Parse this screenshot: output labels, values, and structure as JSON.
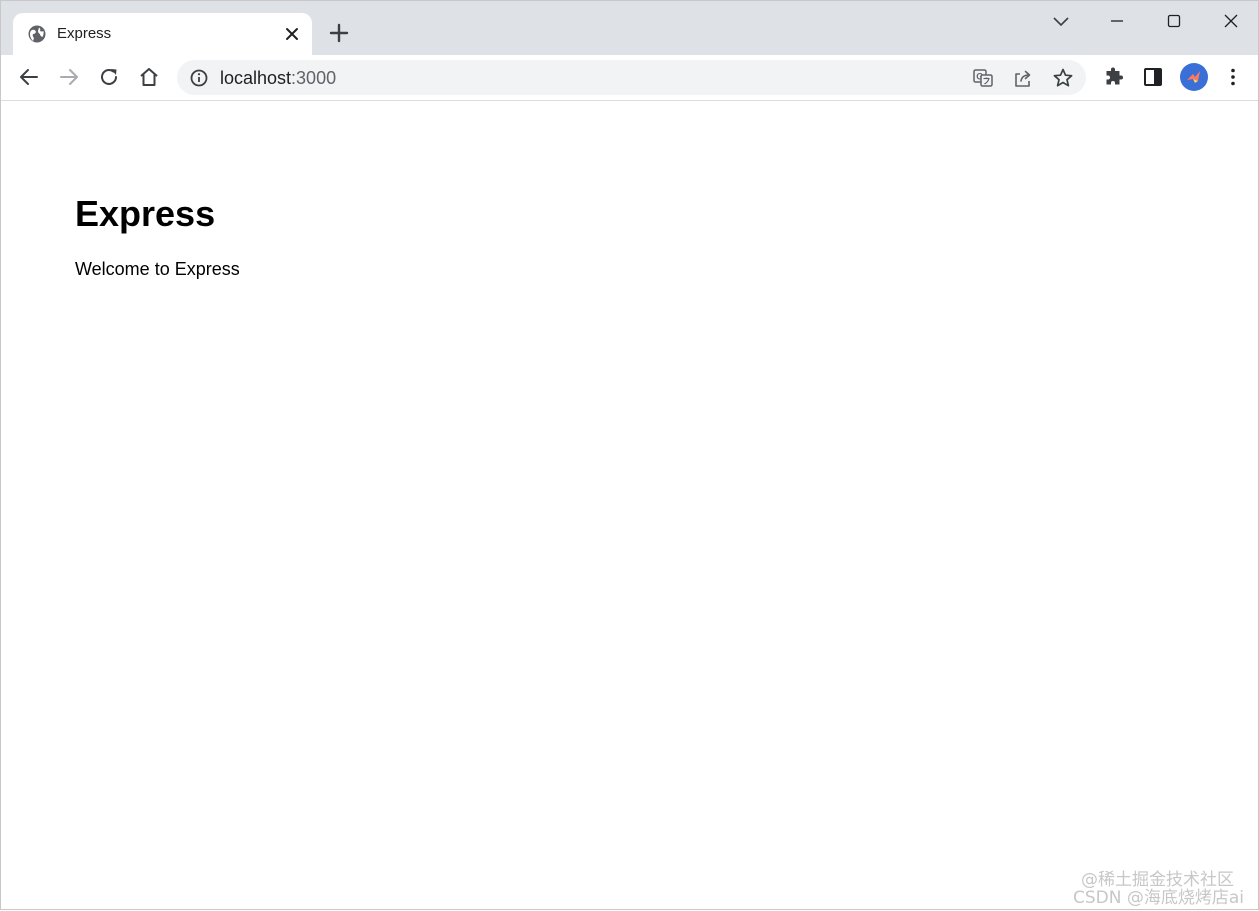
{
  "tab": {
    "title": "Express"
  },
  "address_bar": {
    "host": "localhost",
    "port": ":3000"
  },
  "page": {
    "heading": "Express",
    "paragraph": "Welcome to Express"
  },
  "watermark": {
    "line1": "@稀土掘金技术社区",
    "line2": "CSDN @海底烧烤店ai"
  },
  "icons": {
    "favicon": "globe-icon",
    "tab_close": "close-icon",
    "new_tab": "plus-icon",
    "tab_search": "chevron-down-icon",
    "minimize": "minimize-icon",
    "maximize": "maximize-icon",
    "close_window": "close-icon",
    "back": "arrow-left-icon",
    "forward": "arrow-right-icon",
    "reload": "reload-icon",
    "home": "home-icon",
    "site_info": "info-icon",
    "translate": "translate-icon",
    "share": "share-icon",
    "bookmark": "star-icon",
    "extensions": "puzzle-icon",
    "side_panel": "side-panel-icon",
    "menu": "kebab-menu-icon"
  },
  "colors": {
    "tabstrip_bg": "#dee1e6",
    "omnibox_bg": "#f1f3f4",
    "avatar_bg": "#3b6fd8"
  }
}
